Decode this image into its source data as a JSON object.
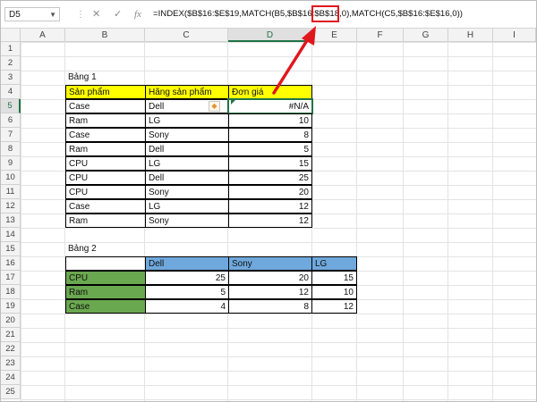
{
  "formula_bar": {
    "name_box": "D5",
    "cancel_icon": "✕",
    "enter_icon": "✓",
    "fx_label": "fx",
    "formula_text": "=INDEX($B$16:$E$19,MATCH(B5,$B$16:$B$18,0),MATCH(C5,$B$16:$E$16,0))"
  },
  "columns": [
    "A",
    "B",
    "C",
    "D",
    "E",
    "F",
    "G",
    "H",
    "I"
  ],
  "rows": [
    "1",
    "2",
    "3",
    "4",
    "5",
    "6",
    "7",
    "8",
    "9",
    "10",
    "11",
    "12",
    "13",
    "14",
    "15",
    "16",
    "17",
    "18",
    "19",
    "20",
    "21",
    "22",
    "23",
    "24",
    "25"
  ],
  "table1": {
    "title": "Bảng 1",
    "headers": [
      "Sản phẩm",
      "Hãng sản phẩm",
      "Đơn giá"
    ],
    "rows": [
      [
        "Case",
        "Dell",
        "#N/A"
      ],
      [
        "Ram",
        "LG",
        "10"
      ],
      [
        "Case",
        "Sony",
        "8"
      ],
      [
        "Ram",
        "Dell",
        "5"
      ],
      [
        "CPU",
        "LG",
        "15"
      ],
      [
        "CPU",
        "Dell",
        "25"
      ],
      [
        "CPU",
        "Sony",
        "20"
      ],
      [
        "Case",
        "LG",
        "12"
      ],
      [
        "Ram",
        "Sony",
        "12"
      ]
    ]
  },
  "table2": {
    "title": "Bảng 2",
    "headers": [
      "",
      "Dell",
      "Sony",
      "LG"
    ],
    "rows": [
      [
        "CPU",
        "25",
        "20",
        "15"
      ],
      [
        "Ram",
        "5",
        "12",
        "10"
      ],
      [
        "Case",
        "4",
        "8",
        "12"
      ]
    ]
  },
  "colors": {
    "header_yellow": "#ffff00",
    "header_blue": "#6fa8dc",
    "row_green": "#6aa84f",
    "highlight_red": "#e0171d",
    "selection_green": "#217346"
  }
}
